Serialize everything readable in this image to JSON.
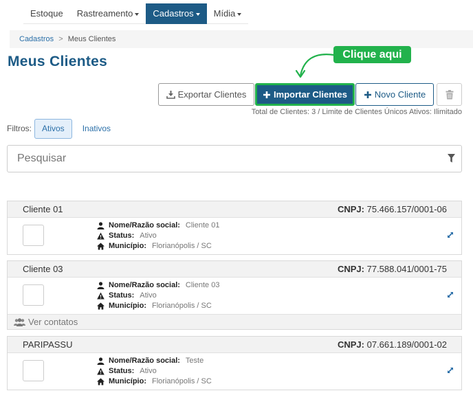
{
  "nav": {
    "items": [
      {
        "label": "Estoque",
        "dropdown": false,
        "active": false
      },
      {
        "label": "Rastreamento",
        "dropdown": true,
        "active": false
      },
      {
        "label": "Cadastros",
        "dropdown": true,
        "active": true
      },
      {
        "label": "Mídia",
        "dropdown": true,
        "active": false
      }
    ]
  },
  "breadcrumb": {
    "root": "Cadastros",
    "separator": ">",
    "current": "Meus Clientes"
  },
  "page_title": "Meus Clientes",
  "callout": "Clique aqui",
  "toolbar": {
    "export_label": "Exportar Clientes",
    "import_label": "Importar Clientes",
    "new_label": "Novo Cliente",
    "totals": "Total de Clientes: 3 / Limite de Clientes Únicos Ativos: Ilimitado"
  },
  "filters": {
    "label": "Filtros:",
    "active": "Ativos",
    "inactive": "Inativos"
  },
  "search": {
    "placeholder": "Pesquisar"
  },
  "clients": [
    {
      "name": "Cliente 01",
      "cnpj_label": "CNPJ:",
      "cnpj": "75.466.157/0001-06",
      "razao_label": "Nome/Razão social:",
      "razao": "Cliente 01",
      "status_label": "Status:",
      "status": "Ativo",
      "municipio_label": "Município:",
      "municipio": "Florianópolis / SC"
    },
    {
      "name": "Cliente 03",
      "cnpj_label": "CNPJ:",
      "cnpj": "77.588.041/0001-75",
      "razao_label": "Nome/Razão social:",
      "razao": "Cliente 03",
      "status_label": "Status:",
      "status": "Ativo",
      "municipio_label": "Município:",
      "municipio": "Florianópolis / SC",
      "contacts_label": "Ver contatos"
    },
    {
      "name": "PARIPASSU",
      "cnpj_label": "CNPJ:",
      "cnpj": "07.661.189/0001-02",
      "razao_label": "Nome/Razão social:",
      "razao": "Teste",
      "status_label": "Status:",
      "status": "Ativo",
      "municipio_label": "Município:",
      "municipio": "Florianópolis / SC"
    }
  ],
  "colors": {
    "primary": "#1d5b86",
    "callout": "#22b24c",
    "link": "#2a6fa8"
  },
  "icons": [
    "download-icon",
    "plus-icon",
    "trash-icon",
    "filter-icon",
    "user-icon",
    "warning-icon",
    "home-icon",
    "expand-icon",
    "users-icon"
  ]
}
